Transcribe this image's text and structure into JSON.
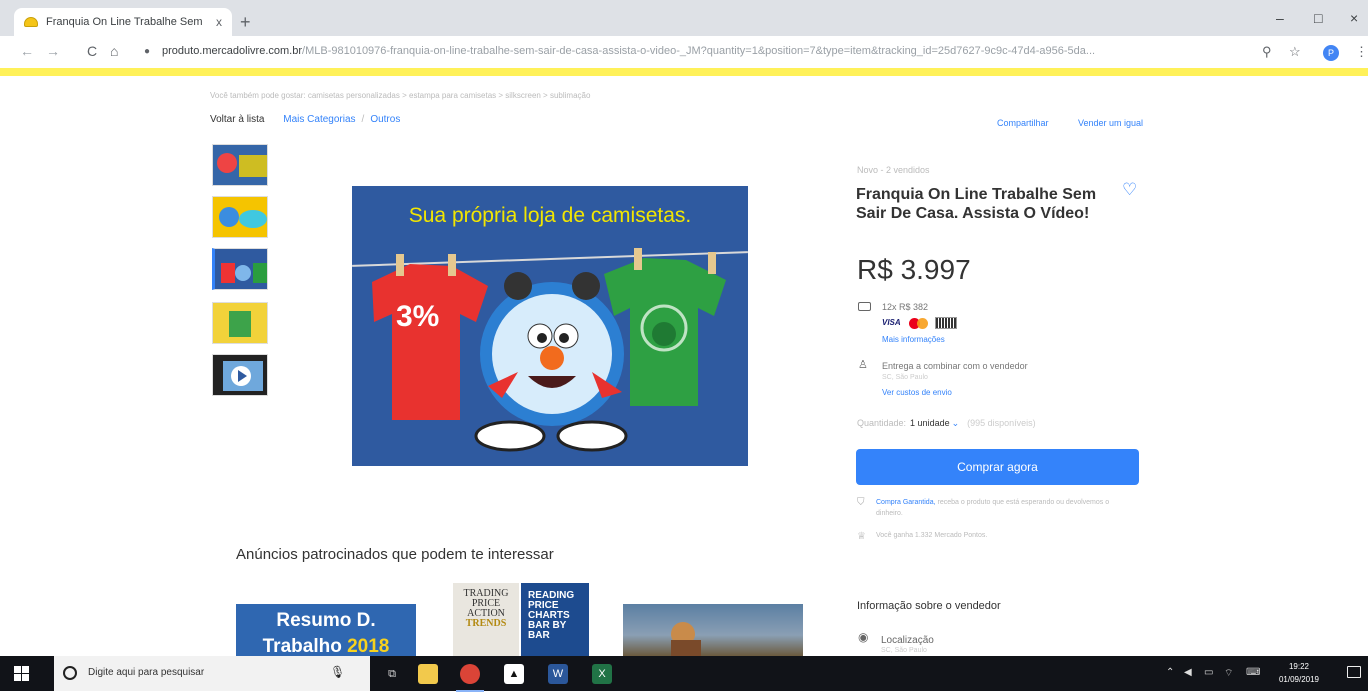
{
  "browser": {
    "tab_title": "Franquia On Line Trabalhe Sem",
    "tab_close": "x",
    "new_tab": "+",
    "minimize": "–",
    "maximize": "□",
    "close": "×",
    "back": "←",
    "forward": "→",
    "reload": "C",
    "home": "⌂",
    "url_domain": "produto.mercadolivre.com.br",
    "url_rest": "/MLB-981010976-franquia-on-line-trabalhe-sem-sair-de-casa-assista-o-video-_JM?quantity=1&position=7&type=item&tracking_id=25d7627-9c9c-47d4-a956-5da...",
    "profile_initial": "P"
  },
  "page": {
    "breadcrumb": "Você também pode gostar: camisetas personalizadas > estampa para camisetas > silkscreen > sublimação",
    "back_label": "Voltar à lista",
    "categories_label": "Mais Categorias",
    "others_label": "Outros",
    "share_label": "Compartilhar",
    "sell_label": "Vender um igual",
    "image_headline": "Sua própria loja de camisetas.",
    "image_tshirt_text": "3%",
    "ads_title": "Anúncios patrocinados que podem te interessar",
    "ad1_line1": "Resumo D.",
    "ad1_line2": "Trabalho ",
    "ad1_year": "2018",
    "ad2_left": [
      "TRADING",
      "PRICE",
      "ACTION",
      "TRENDS"
    ],
    "ad2_right": [
      "READING",
      "PRICE",
      "CHARTS",
      "BAR BY BAR"
    ]
  },
  "product": {
    "status": "Novo - 2 vendidos",
    "title": "Franquia On Line Trabalhe Sem Sair De Casa. Assista O Vídeo!",
    "price": "R$ 3.997",
    "installments": "12x R$ 382",
    "cards_visa": "VISA",
    "more_info": "Mais informações",
    "delivery": "Entrega a combinar com o vendedor",
    "delivery_location": "SC, São Paulo",
    "shipping_cost": "Ver custos de envio",
    "quantity_label": "Quantidade:",
    "quantity_value": "1 unidade",
    "quantity_available": "(995 disponíveis)",
    "buy_button": "Comprar agora",
    "guarantee_link": "Compra Garantida,",
    "guarantee_text": "receba o produto que está esperando ou devolvemos o dinheiro.",
    "points": "Você ganha 1.332 Mercado Pontos.",
    "seller_info_title": "Informação sobre o vendedor",
    "location_label": "Localização",
    "location_value": "SC, São Paulo"
  },
  "taskbar": {
    "search_placeholder": "Digite aqui para pesquisar",
    "time": "19:22",
    "date": "01/09/2019"
  }
}
